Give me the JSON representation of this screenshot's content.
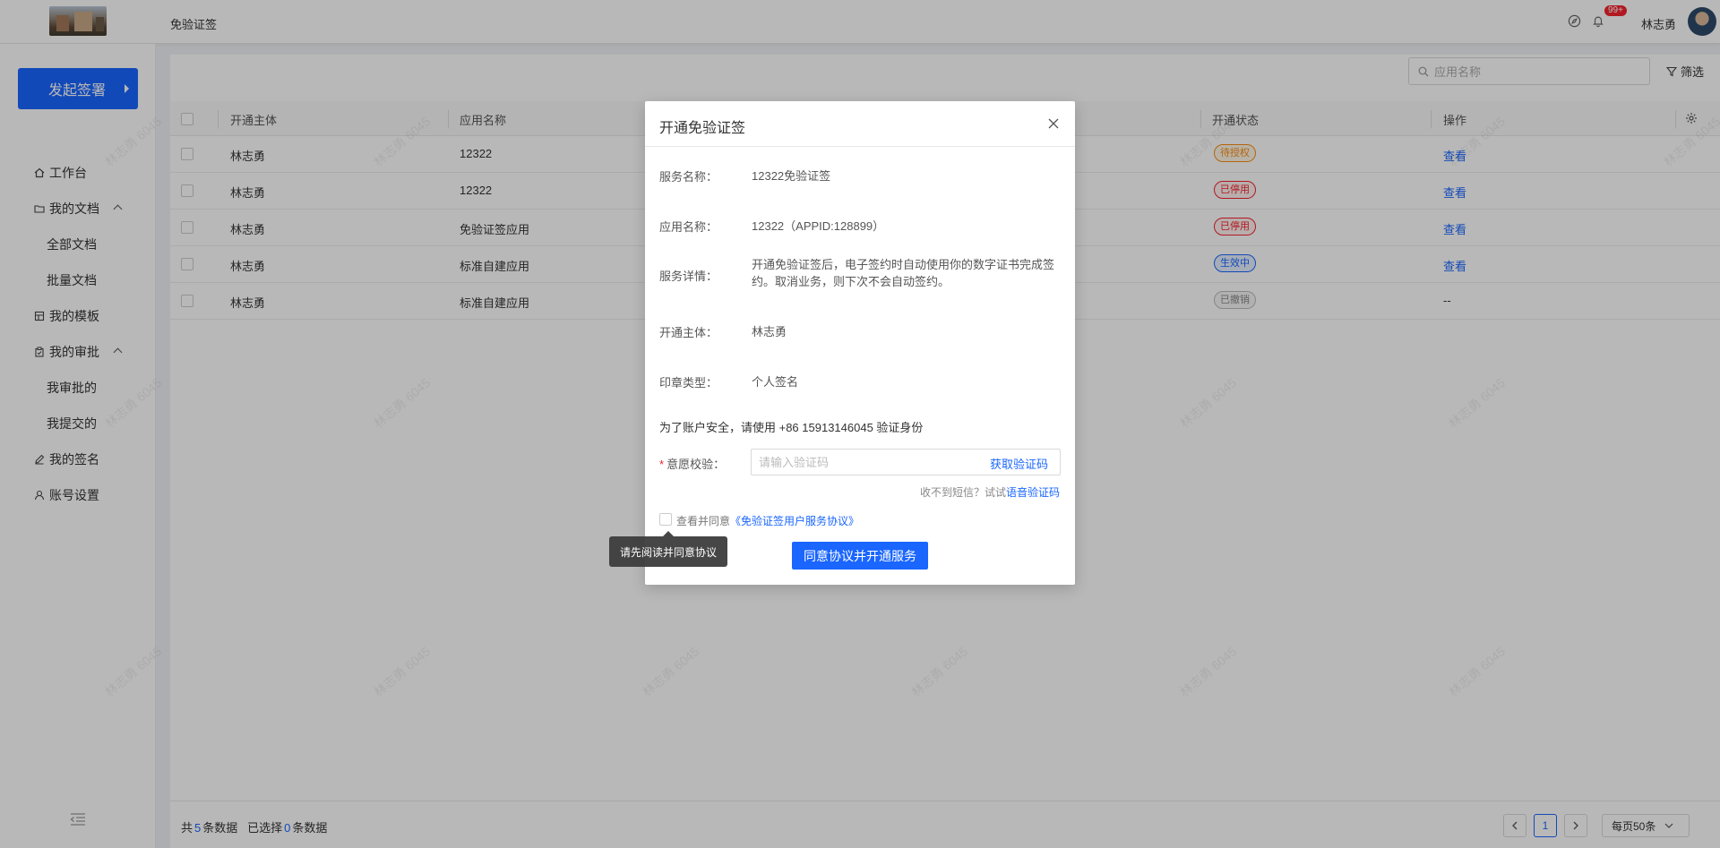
{
  "header": {
    "page_title": "免验证签",
    "notification_badge": "99+",
    "user_name": "林志勇"
  },
  "sidebar": {
    "start_button": "发起签署",
    "items": [
      {
        "label": "工作台",
        "icon": "home-icon"
      },
      {
        "label": "我的文档",
        "icon": "folder-icon"
      },
      {
        "label": "全部文档"
      },
      {
        "label": "批量文档"
      },
      {
        "label": "我的模板",
        "icon": "template-icon"
      },
      {
        "label": "我的审批",
        "icon": "approval-icon"
      },
      {
        "label": "我审批的"
      },
      {
        "label": "我提交的"
      },
      {
        "label": "我的签名",
        "icon": "pen-icon"
      },
      {
        "label": "账号设置",
        "icon": "user-icon"
      }
    ]
  },
  "toolbar": {
    "search_placeholder": "应用名称",
    "filter_label": "筛选"
  },
  "table": {
    "columns": [
      "开通主体",
      "应用名称",
      "开通状态",
      "操作"
    ],
    "rows": [
      {
        "subject": "林志勇",
        "app": "12322",
        "status": "待授权",
        "action": "查看"
      },
      {
        "subject": "林志勇",
        "app": "12322",
        "status": "已停用",
        "action": "查看"
      },
      {
        "subject": "林志勇",
        "app": "免验证签应用",
        "status": "已停用",
        "action": "查看"
      },
      {
        "subject": "林志勇",
        "app": "标准自建应用",
        "status": "生效中",
        "action": "查看"
      },
      {
        "subject": "林志勇",
        "app": "标准自建应用",
        "status": "已撤销",
        "action": "--"
      }
    ]
  },
  "footer": {
    "total_prefix": "共",
    "total_count": "5",
    "total_suffix": "条数据",
    "selected_prefix": "已选择",
    "selected_count": "0",
    "selected_suffix": "条数据",
    "current_page": "1",
    "page_size": "每页50条"
  },
  "watermark": "林志勇 6045",
  "modal": {
    "title": "开通免验证签",
    "fields": [
      {
        "label": "服务名称：",
        "value": "12322免验证签"
      },
      {
        "label": "应用名称：",
        "value": "12322（APPID:128899）"
      },
      {
        "label": "服务详情：",
        "value": "开通免验证签后，电子签约时自动使用你的数字证书完成签约。取消业务，则下次不会自动签约。"
      },
      {
        "label": "开通主体：",
        "value": "林志勇"
      },
      {
        "label": "印章类型：",
        "value": "个人签名"
      }
    ],
    "notice": "为了账户安全，请使用 +86 15913146045 验证身份",
    "verify_label": "意愿校验：",
    "required_mark": "*",
    "code_placeholder": "请输入验证码",
    "get_code": "获取验证码",
    "voice_hint": "收不到短信？试试",
    "voice_link": "语音验证码",
    "agree_text": "查看并同意",
    "agree_link": "《免验证签用户服务协议》",
    "submit": "同意协议并开通服务",
    "tooltip": "请先阅读并同意协议"
  },
  "colors": {
    "primary": "#1a66ff",
    "danger": "#f5222d",
    "warning": "#fa8c16"
  }
}
